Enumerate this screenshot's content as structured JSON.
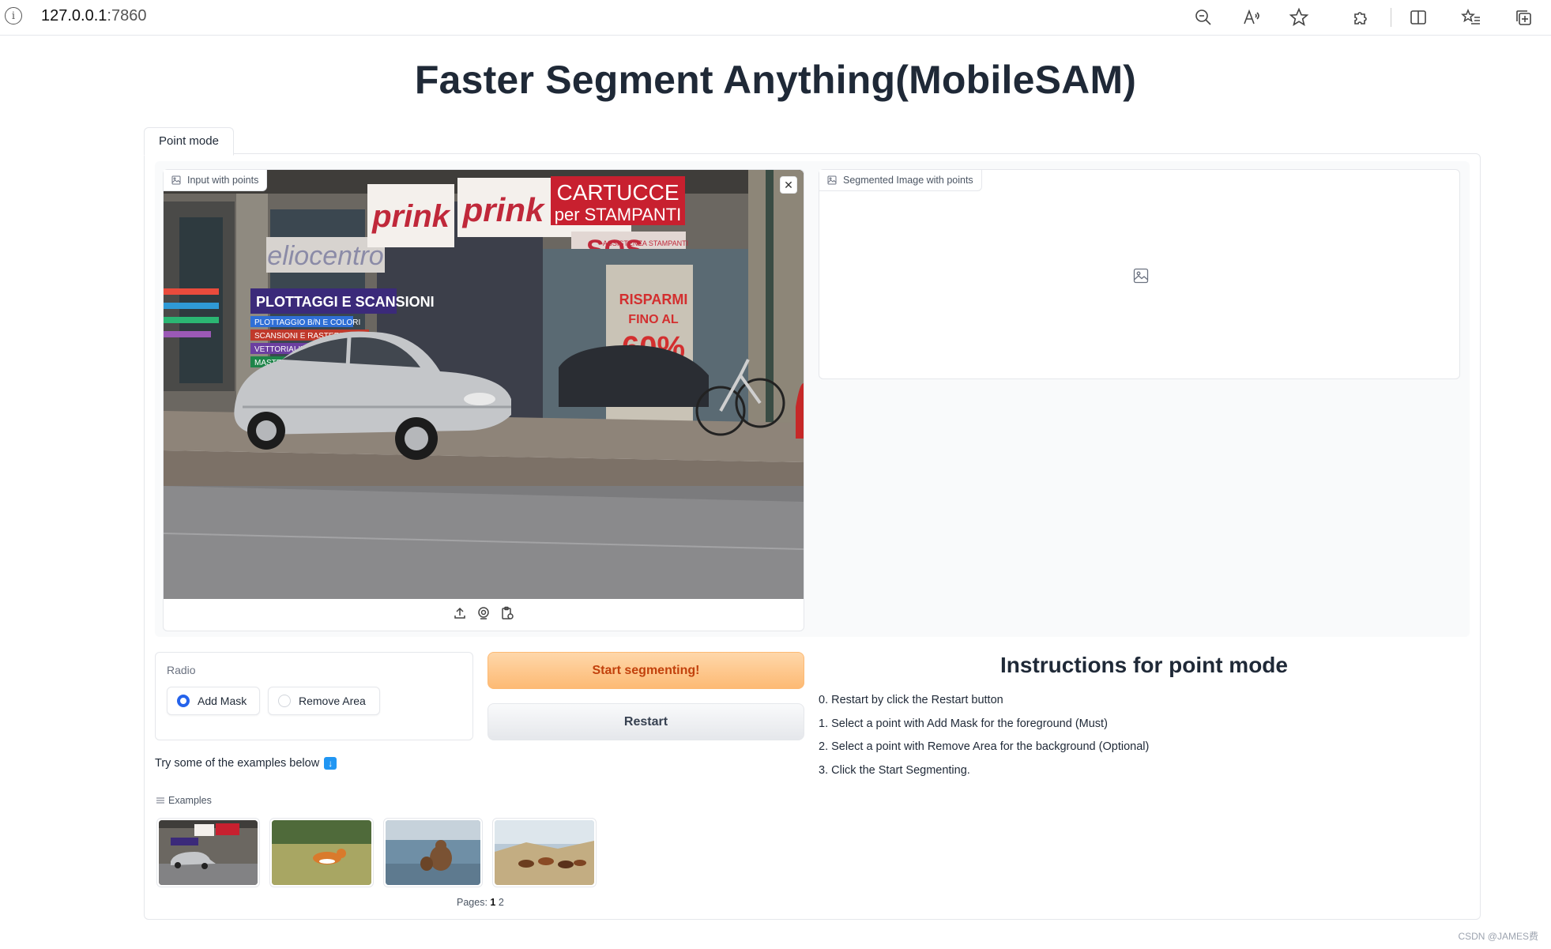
{
  "browser": {
    "url_host": "127.0.0.1",
    "url_port": ":7860"
  },
  "app": {
    "title": "Faster Segment Anything(MobileSAM)"
  },
  "tabs": [
    {
      "label": "Point mode",
      "selected": true
    }
  ],
  "input_image": {
    "label": "Input with points"
  },
  "output_image": {
    "label": "Segmented Image with points"
  },
  "radio": {
    "label": "Radio",
    "options": [
      {
        "label": "Add Mask",
        "selected": true
      },
      {
        "label": "Remove Area",
        "selected": false
      }
    ]
  },
  "buttons": {
    "start": "Start segmenting!",
    "restart": "Restart"
  },
  "instructions": {
    "title": "Instructions for point mode",
    "items": [
      "0. Restart by click the Restart button",
      "1. Select a point with Add Mask for the foreground (Must)",
      "2. Select a point with Remove Area for the background (Optional)",
      "3. Click the Start Segmenting."
    ]
  },
  "examples": {
    "hint": "Try some of the examples below",
    "label": "Examples",
    "pages_label": "Pages:",
    "pages": [
      "1",
      "2"
    ],
    "current_page": "1"
  },
  "photo_signs": {
    "prink1": "prink",
    "prink2": "prink",
    "cartucce": "CARTUCCE",
    "per_stampanti": "per STAMPANTI",
    "sos": "SOS",
    "assistenza": "ASSISTENZA STAMPANTI",
    "eliocentro": "eliocentro",
    "plottaggi": "PLOTTAGGI E SCANSIONI",
    "line1": "PLOTTAGGIO B/N E COLORI",
    "line2": "SCANSIONI E RASTERIZZAZIONI",
    "line3": "VETTORIALIZZAZIONI",
    "line4": "MASTERIZZAZIONI",
    "risparmi": "RISPARMI",
    "fino": "FINO AL",
    "percent": "60%"
  },
  "watermark": "CSDN @JAMES费",
  "colors": {
    "accent_orange": "#fdba74",
    "radio_blue": "#2563eb",
    "border": "#e5e7eb"
  }
}
